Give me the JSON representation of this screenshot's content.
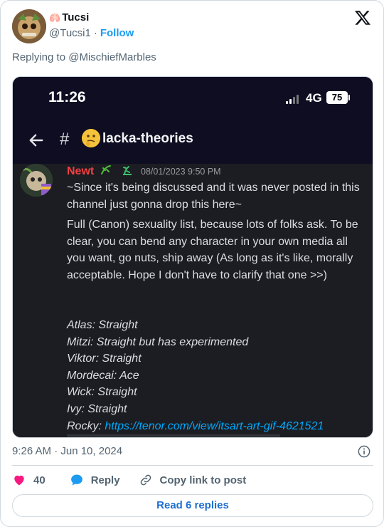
{
  "tweet": {
    "author_name": "Tucsi",
    "author_handle": "@Tucsi1",
    "separator": "·",
    "follow_label": "Follow",
    "replying_prefix": "Replying to",
    "replying_to": "@MischiefMarbles",
    "timestamp": "9:26 AM · Jun 10, 2024",
    "like_count": "40",
    "reply_label": "Reply",
    "copy_label": "Copy link to post",
    "read_replies_label": "Read 6 replies",
    "icons": {
      "logo": "x-logo-icon",
      "info": "info-icon",
      "like": "heart-icon",
      "reply": "reply-bubble-icon",
      "copy": "link-icon"
    },
    "colors": {
      "accent": "#1d9bf0",
      "like": "#f91880",
      "muted": "#536471"
    }
  },
  "screenshot": {
    "time": "11:26",
    "network": "4G",
    "battery": "75",
    "channel": "lacka-theories",
    "message": {
      "author": "Newt",
      "date": "08/01/2023 9:50 PM",
      "line1": "~Since it's being discussed and it was never posted in this channel just gonna drop this here~",
      "line2": "Full (Canon) sexuality list, because lots of folks ask. To be clear, you can bend any character in your own media all you want, go nuts, ship away (As long as it's like, morally acceptable. Hope I don't have to clarify that one >>)",
      "list": [
        "Atlas: Straight",
        "Mitzi: Straight but has experimented",
        "Viktor: Straight",
        "Mordecai: Ace",
        "Wick: Straight",
        "Ivy: Straight"
      ],
      "rocky_label": "Rocky: ",
      "rocky_link": "https://tenor.com/view/itsart-art-gif-4621521"
    },
    "colors": {
      "author": "#f23f42",
      "link": "#00a8fc",
      "bg": "#1c1d22",
      "header": "#0e0d22"
    }
  }
}
